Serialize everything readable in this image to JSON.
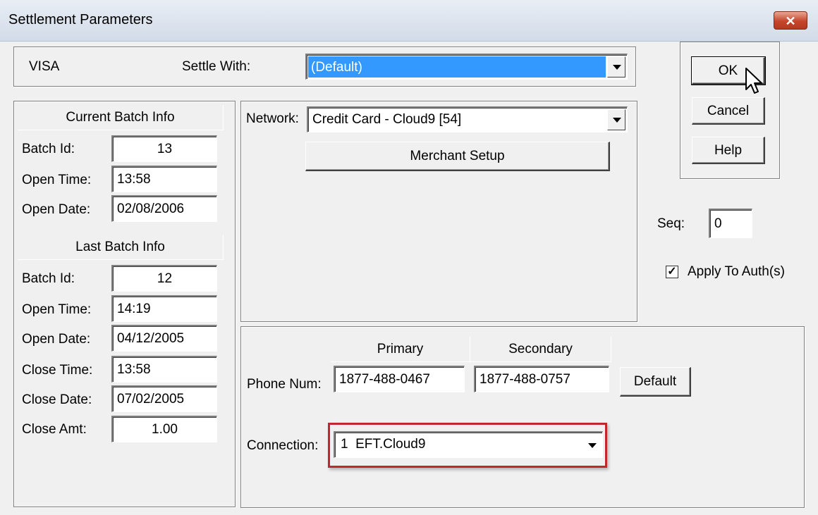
{
  "window": {
    "title": "Settlement Parameters",
    "close_glyph": "✕"
  },
  "top": {
    "card_type": "VISA",
    "settle_with_label": "Settle With:",
    "settle_with_value": "(Default)"
  },
  "dialog_buttons": {
    "ok": "OK",
    "cancel": "Cancel",
    "help": "Help"
  },
  "current_batch": {
    "header": "Current Batch Info",
    "batch_id_label": "Batch Id:",
    "batch_id": "13",
    "open_time_label": "Open Time:",
    "open_time": "13:58",
    "open_date_label": "Open Date:",
    "open_date": "02/08/2006"
  },
  "last_batch": {
    "header": "Last Batch Info",
    "batch_id_label": "Batch Id:",
    "batch_id": "12",
    "open_time_label": "Open Time:",
    "open_time": "14:19",
    "open_date_label": "Open Date:",
    "open_date": "04/12/2005",
    "close_time_label": "Close Time:",
    "close_time": "13:58",
    "close_date_label": "Close Date:",
    "close_date": "07/02/2005",
    "close_amt_label": "Close Amt:",
    "close_amt": "1.00"
  },
  "network": {
    "label": "Network:",
    "value": "Credit Card - Cloud9  [54]",
    "merchant_setup_label": "Merchant Setup"
  },
  "seq": {
    "label": "Seq:",
    "value": "0"
  },
  "apply_to_auth": {
    "label": "Apply To Auth(s)",
    "checked": true,
    "check_glyph": "✓"
  },
  "phone": {
    "primary_header": "Primary",
    "secondary_header": "Secondary",
    "label": "Phone Num:",
    "primary": "1877-488-0467",
    "secondary": "1877-488-0757",
    "default_button": "Default"
  },
  "connection": {
    "label": "Connection:",
    "value": "1  EFT.Cloud9"
  },
  "colors": {
    "highlight": "#3399ff",
    "annotation_box": "#c0282d"
  }
}
